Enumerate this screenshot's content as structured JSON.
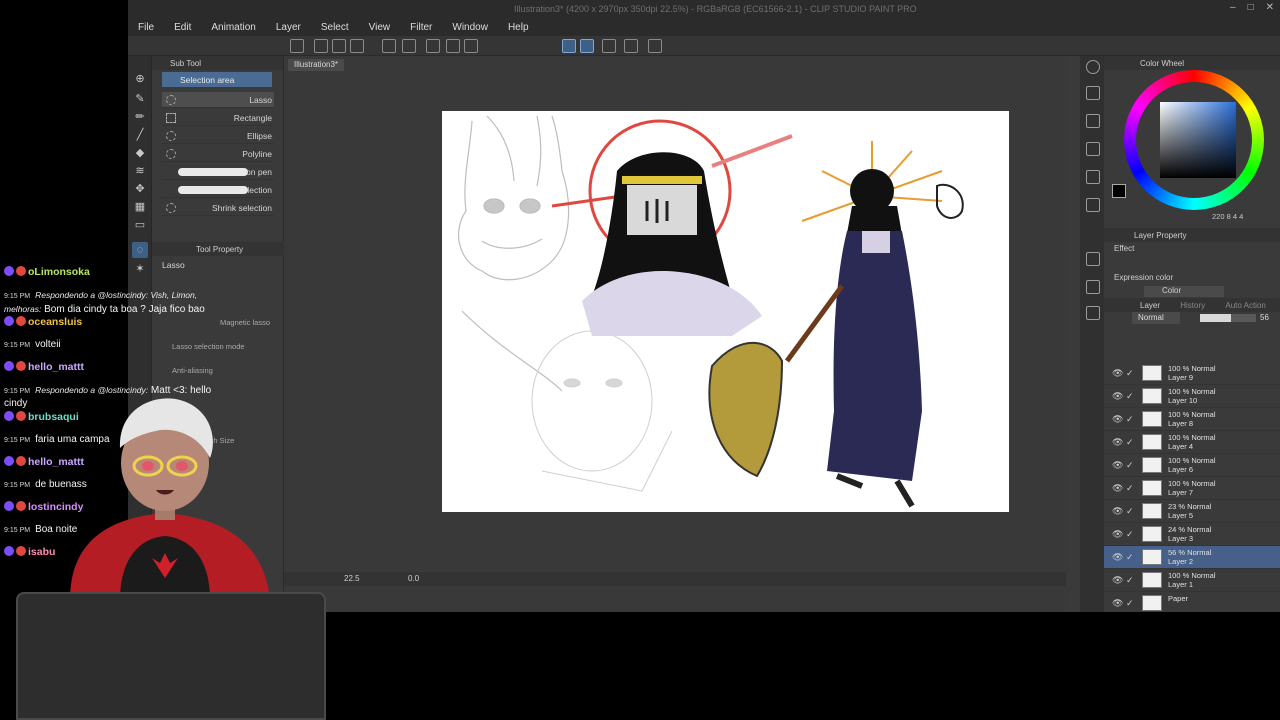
{
  "window": {
    "title": "Illustration3* (4200 x 2970px 350dpi 22.5%) - RGBaRGB (EC61566-2.1) - CLIP STUDIO PAINT PRO",
    "controls": [
      "–",
      "□",
      "✕"
    ]
  },
  "menu": [
    "File",
    "Edit",
    "Animation",
    "Layer",
    "Select",
    "View",
    "Filter",
    "Window",
    "Help"
  ],
  "subtool_panel": {
    "header": "Sub Tool",
    "group": "Selection area",
    "items": [
      "Lasso",
      "Rectangle",
      "Ellipse",
      "Polyline",
      "Selection pen",
      "Erase selection",
      "Shrink selection"
    ],
    "active_item": "Lasso"
  },
  "tool_property": {
    "header": "Tool Property",
    "tool_name": "Lasso",
    "rows": [
      "Magnetic lasso",
      "Lasso selection mode",
      "Anti-aliasing"
    ]
  },
  "brush_size_label": "Brush Size",
  "document": {
    "tab": "Illustration3*",
    "zoom": "22.5",
    "rotation": "0.0"
  },
  "color_wheel": {
    "header": "Color Wheel",
    "main_color": "#000000",
    "values": "220  8  4  4"
  },
  "layer_property": {
    "header": "Layer Property",
    "effect_label": "Effect",
    "expression_color_label": "Expression color",
    "expression_color_value": "Color"
  },
  "layer_panel": {
    "tabs": [
      "Layer",
      "History",
      "Auto Action"
    ],
    "blend_mode": "Normal",
    "opacity": "56",
    "opacity_fraction": 0.56,
    "layers": [
      {
        "mode": "100 % Normal",
        "name": "Layer 9",
        "selected": false
      },
      {
        "mode": "100 % Normal",
        "name": "Layer 10",
        "selected": false
      },
      {
        "mode": "100 % Normal",
        "name": "Layer 8",
        "selected": false
      },
      {
        "mode": "100 % Normal",
        "name": "Layer 4",
        "selected": false
      },
      {
        "mode": "100 % Normal",
        "name": "Layer 6",
        "selected": false
      },
      {
        "mode": "100 % Normal",
        "name": "Layer 7",
        "selected": false
      },
      {
        "mode": "23 % Normal",
        "name": "Layer 5",
        "selected": false
      },
      {
        "mode": "24 % Normal",
        "name": "Layer 3",
        "selected": false
      },
      {
        "mode": "56 % Normal",
        "name": "Layer 2",
        "selected": true
      },
      {
        "mode": "100 % Normal",
        "name": "Layer 1",
        "selected": false
      },
      {
        "mode": "",
        "name": "Paper",
        "selected": false
      }
    ]
  },
  "chat": [
    {
      "user": "oLimonsoka",
      "user_color": "#b9e85a",
      "time": "",
      "reply": "",
      "text": ""
    },
    {
      "user": "",
      "user_color": "#ffffff",
      "time": "9:15 PM",
      "reply": "Respondendo a @lostincindy: Vish, Limon, melhoras:",
      "text": "Bom dia cindy ta boa ? Jaja fico bao"
    },
    {
      "user": "oceansluis",
      "user_color": "#f0c24a",
      "time": "",
      "reply": "",
      "text": ""
    },
    {
      "user": "",
      "user_color": "#ffffff",
      "time": "9:15 PM",
      "reply": "",
      "text": "volteii"
    },
    {
      "user": "hello_mattt",
      "user_color": "#c9a8ff",
      "time": "",
      "reply": "",
      "text": ""
    },
    {
      "user": "",
      "user_color": "#ffffff",
      "time": "9:15 PM",
      "reply": "Respondendo a @lostincindy:",
      "text": "Matt <3: hello cindy"
    },
    {
      "user": "brubsaqui",
      "user_color": "#6fd9c9",
      "time": "",
      "reply": "",
      "text": ""
    },
    {
      "user": "",
      "user_color": "#ffffff",
      "time": "9:15 PM",
      "reply": "",
      "text": "faria uma campa"
    },
    {
      "user": "hello_mattt",
      "user_color": "#c9a8ff",
      "time": "",
      "reply": "",
      "text": ""
    },
    {
      "user": "",
      "user_color": "#ffffff",
      "time": "9:15 PM",
      "reply": "",
      "text": "de buenass"
    },
    {
      "user": "lostincindy",
      "user_color": "#d68cff",
      "time": "",
      "reply": "",
      "text": ""
    },
    {
      "user": "",
      "user_color": "#ffffff",
      "time": "9:15 PM",
      "reply": "",
      "text": "Boa noite"
    },
    {
      "user": "isabu",
      "user_color": "#ff8cb4",
      "time": "",
      "reply": "",
      "text": ""
    }
  ],
  "colors": {
    "accent": "#4a6c94",
    "app_bg": "#3a3a3a",
    "halo_red": "#e0473f"
  }
}
